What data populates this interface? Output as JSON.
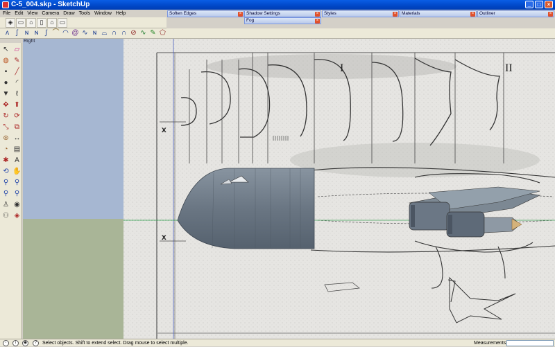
{
  "window": {
    "title": "C-5_004.skp - SketchUp",
    "controls": [
      "minimize",
      "maximize",
      "close"
    ]
  },
  "menu": [
    "File",
    "Edit",
    "View",
    "Camera",
    "Draw",
    "Tools",
    "Window",
    "Help"
  ],
  "dialogs": [
    {
      "label": "Soften Edges"
    },
    {
      "label": "Shadow Settings"
    },
    {
      "label": "Fog"
    },
    {
      "label": "Styles"
    },
    {
      "label": "Materials"
    },
    {
      "label": "Outliner"
    }
  ],
  "views_toolbar": [
    "iso-icon",
    "top-icon",
    "front-icon",
    "right-icon",
    "back-icon",
    "left-icon"
  ],
  "sandbox_toolbar": [
    "freehand-icon",
    "arc-icon",
    "curve-icon",
    "spline-icon",
    "bezier-icon",
    "smooth-icon",
    "circle-arc-icon",
    "spiral-icon",
    "wave-icon",
    "blob-icon",
    "parabola-icon",
    "helix-icon",
    "offset-icon",
    "zigzag-icon",
    "vine-icon",
    "pin-icon",
    "poly-icon"
  ],
  "left_tools": [
    "select-icon",
    "eraser-icon",
    "paint-icon",
    "pencil-icon",
    "rectangle-icon",
    "line-icon",
    "circle-icon",
    "arc-icon",
    "polygon-icon",
    "freehand-icon",
    "move-icon",
    "pushpull-icon",
    "rotate-icon",
    "followme-icon",
    "scale-icon",
    "offset-icon",
    "tape-icon",
    "dimension-icon",
    "protractor-icon",
    "text-icon",
    "axes-icon",
    "3dtext-icon",
    "orbit-icon",
    "pan-icon",
    "zoom-icon",
    "zoomwindow-icon",
    "zoomext-icon",
    "previous-icon",
    "position-icon",
    "look-icon",
    "walk-icon",
    "section-icon"
  ],
  "viewport": {
    "view_label": "Right"
  },
  "status": {
    "hint": "Select objects. Shift to extend select. Drag mouse to select multiple.",
    "measurements_label": "Measurements",
    "measurements_value": ""
  },
  "blueprint": {
    "roman_1": "I",
    "roman_2": "II",
    "mark_1": "x",
    "mark_2": "x"
  }
}
